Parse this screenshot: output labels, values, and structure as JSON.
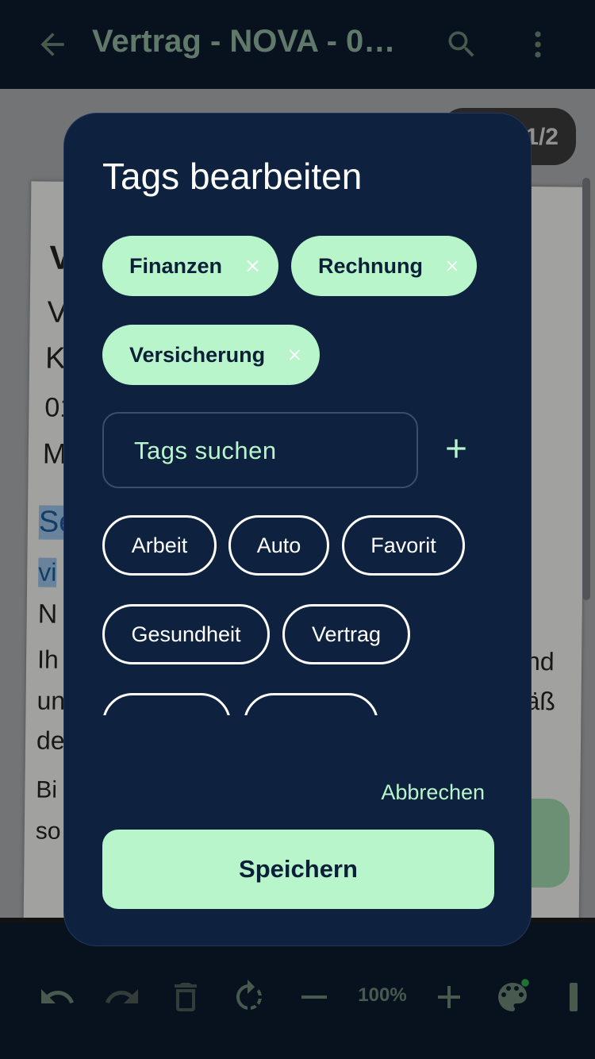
{
  "app": {
    "title": "Vertrag - NOVA - 01....",
    "page_indicator": "1/2",
    "zoom": "100%"
  },
  "document_fragments": [
    {
      "text": "V",
      "bold": true
    },
    {
      "text": "V"
    },
    {
      "text": "K"
    },
    {
      "text": "01"
    },
    {
      "text": "M"
    },
    {
      "text": "Se",
      "highlight": true
    },
    {
      "text": "vi",
      "highlight": true
    },
    {
      "text": "N"
    },
    {
      "text": "Ih"
    },
    {
      "text": "un"
    },
    {
      "text": "de"
    },
    {
      "text": "Bi"
    },
    {
      "text": "so"
    },
    {
      "text": "nd"
    },
    {
      "text": "äß"
    }
  ],
  "dialog": {
    "title": "Tags bearbeiten",
    "selected_tags": [
      "Finanzen",
      "Rechnung",
      "Versicherung"
    ],
    "search_placeholder": "Tags suchen",
    "available_tags": [
      "Arbeit",
      "Auto",
      "Favorit",
      "Gesundheit",
      "Vertrag"
    ],
    "cancel_label": "Abbrechen",
    "save_label": "Speichern"
  },
  "colors": {
    "accent": "#b9f5cb",
    "dialog_bg": "#0e2240",
    "app_bg": "#0d1b2e",
    "muted_icon": "#6b8574"
  },
  "icons": {
    "topbar": [
      "arrow-back-icon",
      "search-icon",
      "more-vert-icon"
    ],
    "toolbar": [
      "undo-icon",
      "redo-icon",
      "delete-icon",
      "rotate-icon",
      "zoom-out-icon",
      "zoom-in-icon",
      "palette-icon",
      "highlighter-icon"
    ]
  }
}
